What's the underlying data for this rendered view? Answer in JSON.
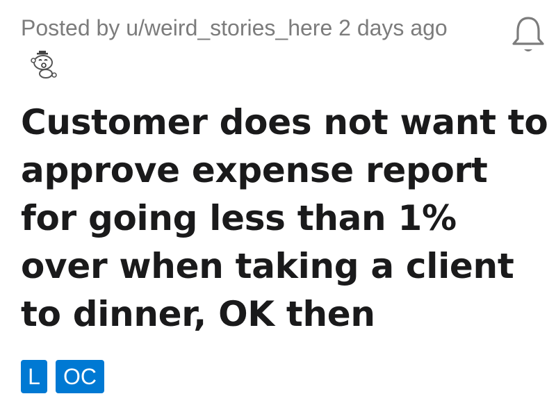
{
  "post": {
    "meta": {
      "posted_by_prefix": "Posted by ",
      "username": "u/weird_stories_here",
      "time_ago": " 2 days ago"
    },
    "title": "Customer does not want to approve expense report for going less than 1% over when taking a client to dinner, OK then",
    "flairs": [
      {
        "label": "L",
        "color": "#0079d3"
      },
      {
        "label": "OC",
        "color": "#0079d3"
      }
    ]
  },
  "icons": {
    "notification": "bell-icon",
    "avatar": "snoo-avatar-icon"
  },
  "colors": {
    "meta_text": "#7c7c7c",
    "title_text": "#1a1a1b",
    "flair_blue": "#0079d3"
  }
}
